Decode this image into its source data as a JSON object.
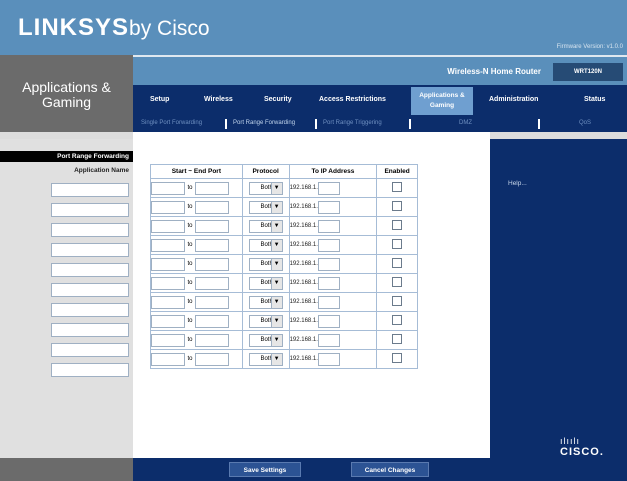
{
  "brand": {
    "logo_text": "LINKSYS",
    "logo_by": "by Cisco",
    "firmware": "Firmware Version: v1.0.0"
  },
  "section": {
    "title": "Applications & Gaming"
  },
  "router": {
    "name": "Wireless-N Home Router",
    "model": "WRT120N"
  },
  "main_nav": [
    {
      "label": "Setup"
    },
    {
      "label": "Wireless"
    },
    {
      "label": "Security"
    },
    {
      "label": "Access Restrictions"
    },
    {
      "label": "Applications & Gaming",
      "active": true
    },
    {
      "label": "Administration"
    },
    {
      "label": "Status"
    }
  ],
  "sub_nav": [
    {
      "label": "Single Port Forwarding"
    },
    {
      "label": "Port Range Forwarding",
      "active": true
    },
    {
      "label": "Port Range Triggering"
    },
    {
      "label": "DMZ"
    },
    {
      "label": "QoS"
    }
  ],
  "left_panel": {
    "heading": "Port Range Forwarding",
    "app_name_label": "Application Name"
  },
  "table": {
    "headers": [
      "Start ~ End Port",
      "Protocol",
      "To IP Address",
      "Enabled"
    ],
    "to_label": "to",
    "protocol_value": "Both",
    "ip_prefix": "192.168.1.",
    "row_count": 10
  },
  "help": {
    "label": "Help..."
  },
  "buttons": {
    "save": "Save Settings",
    "cancel": "Cancel Changes"
  },
  "cisco": {
    "bars": "ılıılı",
    "text": "CISCO."
  },
  "colors": {
    "brand_blue": "#5a8fbb",
    "navy": "#0c2d6b",
    "grey": "#6b6b6b"
  }
}
